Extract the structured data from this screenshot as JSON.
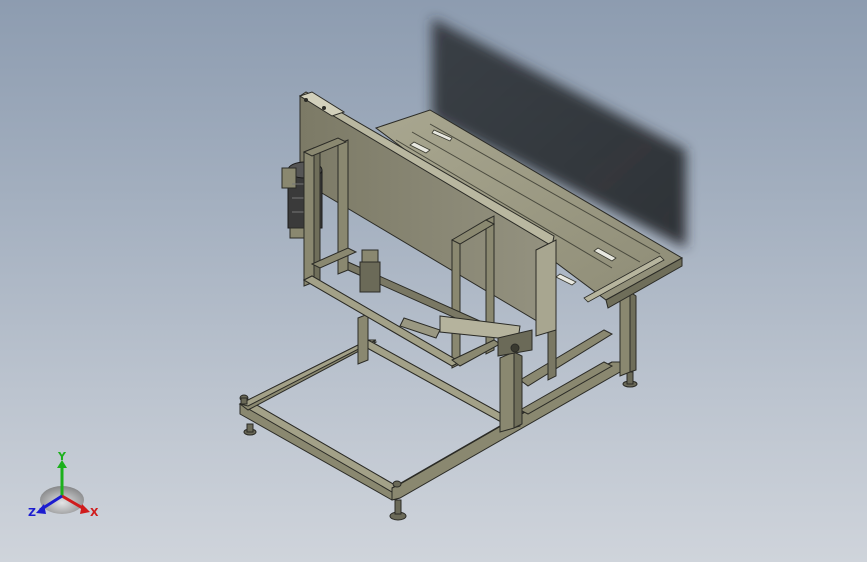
{
  "viewport": {
    "background_top": "#8d9cb0",
    "background_bottom": "#cfd4db"
  },
  "model": {
    "frame_color": "#8a8870",
    "frame_dark": "#5d5c4a",
    "frame_edge": "#2b2b26",
    "panel_color": "#9a9882",
    "shadow_color": "#2a2c31",
    "motor_color": "#3a3a3a"
  },
  "triad": {
    "x_label": "X",
    "y_label": "Y",
    "z_label": "Z",
    "x_color": "#d01c1c",
    "y_color": "#1cb01c",
    "z_color": "#1c1cd0"
  }
}
